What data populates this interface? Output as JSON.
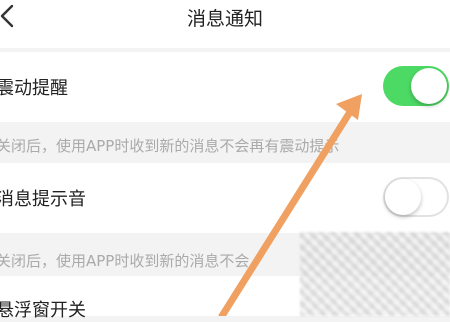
{
  "header": {
    "title": "消息通知",
    "back_icon": "chevron-left-icon"
  },
  "settings": [
    {
      "label": "震动提醒",
      "enabled": true,
      "note": "关闭后，使用APP时收到新的消息不会再有震动提示"
    },
    {
      "label": "消息提示音",
      "enabled": false,
      "note": "关闭后，使用APP时收到新的消息不会"
    },
    {
      "label": "悬浮窗开关"
    }
  ],
  "colors": {
    "toggle_on": "#4cd964",
    "annotation_arrow": "#f0a060"
  }
}
